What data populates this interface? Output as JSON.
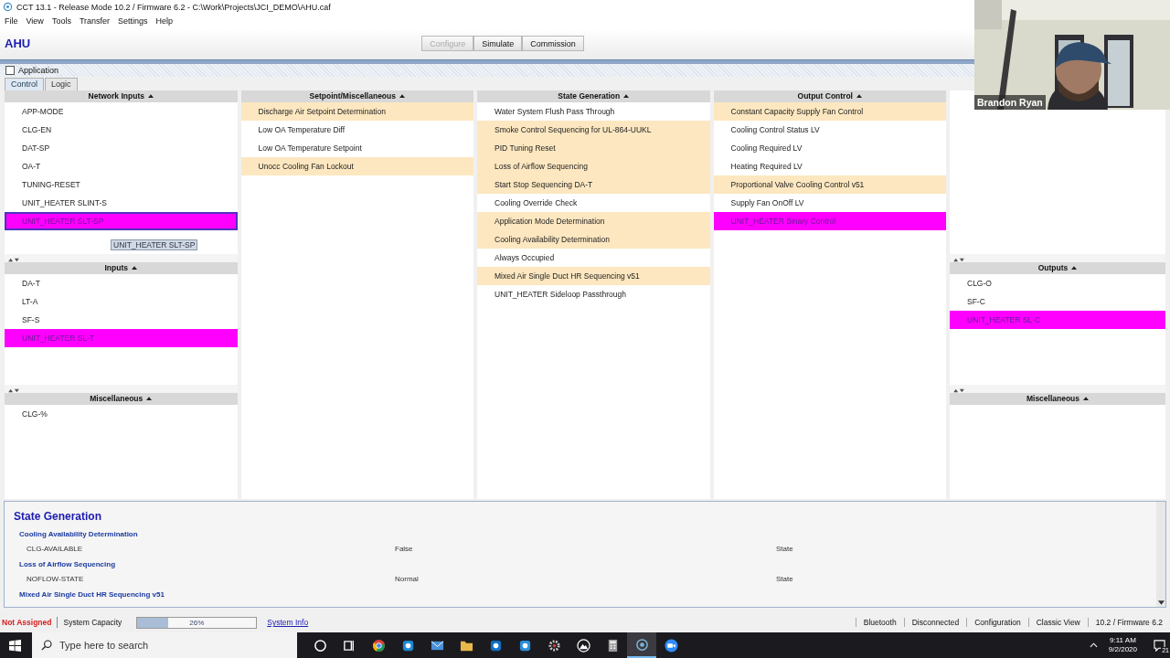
{
  "window": {
    "title": "CCT 13.1 - Release Mode 10.2 / Firmware 6.2 - C:\\Work\\Projects\\JCI_DEMO\\AHU.caf"
  },
  "menu": [
    "File",
    "View",
    "Tools",
    "Transfer",
    "Settings",
    "Help"
  ],
  "header": {
    "title": "AHU",
    "buttons": [
      {
        "label": "Configure",
        "disabled": true
      },
      {
        "label": "Simulate",
        "disabled": false
      },
      {
        "label": "Commission",
        "disabled": false
      }
    ]
  },
  "panel": {
    "title": "Application",
    "checked": false
  },
  "tabs": [
    {
      "label": "Control",
      "selected": true
    },
    {
      "label": "Logic",
      "selected": false
    }
  ],
  "columns": [
    {
      "sections": [
        {
          "title": "Network Inputs",
          "items": [
            {
              "label": "APP-MODE",
              "highlighted": false,
              "selected": false
            },
            {
              "label": "CLG-EN",
              "highlighted": false,
              "selected": false
            },
            {
              "label": "DAT-SP",
              "highlighted": false,
              "selected": false
            },
            {
              "label": "OA-T",
              "highlighted": false,
              "selected": false
            },
            {
              "label": "TUNING-RESET",
              "highlighted": false,
              "selected": false
            },
            {
              "label": "UNIT_HEATER SLINT-S",
              "highlighted": false,
              "selected": false
            },
            {
              "label": "UNIT_HEATER SLT-SP",
              "highlighted": false,
              "selected": true
            }
          ],
          "tooltip": "UNIT_HEATER SLT-SP"
        },
        {
          "title": "Inputs",
          "items": [
            {
              "label": "DA-T",
              "highlighted": false,
              "selected": false
            },
            {
              "label": "LT-A",
              "highlighted": false,
              "selected": false
            },
            {
              "label": "SF-S",
              "highlighted": false,
              "selected": false
            },
            {
              "label": "UNIT_HEATER SL-T",
              "highlighted": false,
              "selected": true
            }
          ]
        },
        {
          "title": "Miscellaneous",
          "items": [
            {
              "label": "CLG-%",
              "highlighted": false,
              "selected": false
            }
          ]
        }
      ]
    },
    {
      "sections": [
        {
          "title": "Setpoint/Miscellaneous",
          "items": [
            {
              "label": "Discharge Air Setpoint Determination",
              "highlighted": true,
              "selected": false
            },
            {
              "label": "Low OA Temperature Diff",
              "highlighted": false,
              "selected": false
            },
            {
              "label": "Low OA Temperature Setpoint",
              "highlighted": false,
              "selected": false
            },
            {
              "label": "Unocc Cooling Fan Lockout",
              "highlighted": true,
              "selected": false
            }
          ]
        }
      ]
    },
    {
      "sections": [
        {
          "title": "State Generation",
          "items": [
            {
              "label": "Water System Flush Pass Through",
              "highlighted": false,
              "selected": false
            },
            {
              "label": "Smoke Control Sequencing for UL-864-UUKL",
              "highlighted": true,
              "selected": false
            },
            {
              "label": "PID Tuning Reset",
              "highlighted": true,
              "selected": false
            },
            {
              "label": "Loss of Airflow Sequencing",
              "highlighted": true,
              "selected": false
            },
            {
              "label": "Start Stop Sequencing DA-T",
              "highlighted": true,
              "selected": false
            },
            {
              "label": "Cooling Override Check",
              "highlighted": false,
              "selected": false
            },
            {
              "label": "Application Mode Determination",
              "highlighted": true,
              "selected": false
            },
            {
              "label": "Cooling Availability Determination",
              "highlighted": true,
              "selected": false
            },
            {
              "label": "Always Occupied",
              "highlighted": false,
              "selected": false
            },
            {
              "label": "Mixed Air Single Duct HR Sequencing v51",
              "highlighted": true,
              "selected": false
            },
            {
              "label": "UNIT_HEATER Sideloop Passthrough",
              "highlighted": false,
              "selected": false
            }
          ]
        }
      ]
    },
    {
      "sections": [
        {
          "title": "Output Control",
          "items": [
            {
              "label": "Constant Capacity Supply Fan Control",
              "highlighted": true,
              "selected": false
            },
            {
              "label": "Cooling Control Status LV",
              "highlighted": false,
              "selected": false
            },
            {
              "label": "Cooling Required LV",
              "highlighted": false,
              "selected": false
            },
            {
              "label": "Heating Required LV",
              "highlighted": false,
              "selected": false
            },
            {
              "label": "Proportional Valve Cooling Control v51",
              "highlighted": true,
              "selected": false
            },
            {
              "label": "Supply Fan OnOff LV",
              "highlighted": false,
              "selected": false
            },
            {
              "label": "UNIT_HEATER Binary Control",
              "highlighted": false,
              "selected": true
            }
          ]
        }
      ]
    },
    {
      "sections": [
        {
          "kind": "blank"
        },
        {
          "title": "Outputs",
          "items": [
            {
              "label": "CLG-O",
              "highlighted": false,
              "selected": false
            },
            {
              "label": "SF-C",
              "highlighted": false,
              "selected": false
            },
            {
              "label": "UNIT_HEATER SL-C",
              "highlighted": false,
              "selected": true
            }
          ]
        },
        {
          "title": "Miscellaneous"
        }
      ]
    }
  ],
  "details": {
    "title": "State Generation",
    "groups": [
      {
        "name": "Cooling Availability Determination",
        "rows": [
          {
            "name": "CLG-AVAILABLE",
            "value": "False",
            "type": "State"
          }
        ]
      },
      {
        "name": "Loss of Airflow Sequencing",
        "rows": [
          {
            "name": "NOFLOW-STATE",
            "value": "Normal",
            "type": "State"
          }
        ]
      },
      {
        "name": "Mixed Air Single Duct HR Sequencing v51"
      }
    ]
  },
  "status_bar": {
    "assignment": "Not Assigned",
    "capacity_label": "System Capacity",
    "capacity": {
      "level": 0.26,
      "reading": "26%"
    },
    "link": "System Info",
    "fields": [
      "Bluetooth",
      "Disconnected",
      "Configuration",
      "Classic View",
      "10.2 / Firmware 6.2"
    ]
  },
  "video": {
    "kind": "picture",
    "name": "Brandon Ryan"
  },
  "taskbar": {
    "search": {
      "placeholder": "Type here to search"
    },
    "apps": [
      {
        "kind": "circle",
        "selected": false
      },
      {
        "kind": "taskview",
        "selected": false
      },
      {
        "kind": "chrome",
        "selected": false
      },
      {
        "kind": "edge",
        "selected": false
      },
      {
        "kind": "mail",
        "selected": false
      },
      {
        "kind": "folder",
        "selected": false
      },
      {
        "kind": "outlook",
        "selected": false
      },
      {
        "kind": "ie",
        "selected": false
      },
      {
        "kind": "gear",
        "selected": false
      },
      {
        "kind": "mountain",
        "selected": false
      },
      {
        "kind": "calculator",
        "selected": false
      },
      {
        "kind": "app",
        "selected": true
      },
      {
        "kind": "camera",
        "selected": false
      }
    ],
    "time": "9:11 AM",
    "date": "9/2/2020",
    "notifications": "21"
  }
}
